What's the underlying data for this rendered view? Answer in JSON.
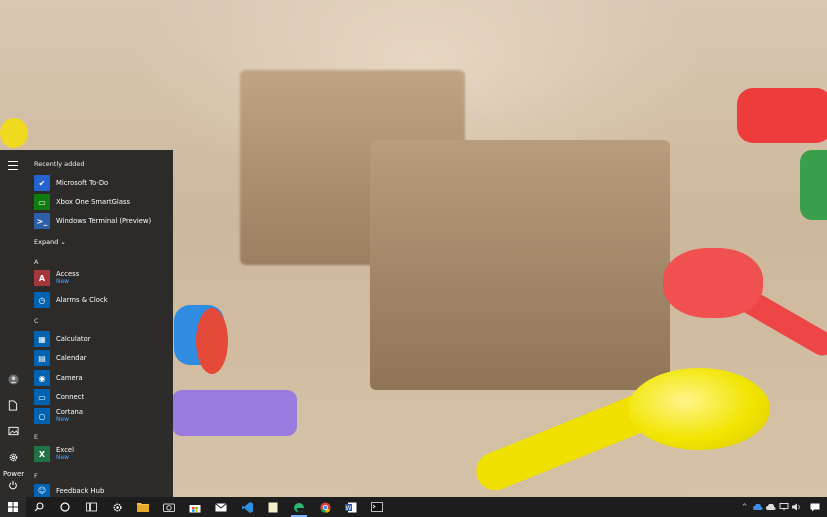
{
  "start_menu": {
    "recently_added_label": "Recently added",
    "recent": [
      {
        "name": "Microsoft To-Do",
        "icon": "checkmark-icon",
        "color": "#2564cf"
      },
      {
        "name": "Xbox One SmartGlass",
        "icon": "xbox-icon",
        "color": "#107c10"
      },
      {
        "name": "Windows Terminal (Preview)",
        "icon": "terminal-icon",
        "color": "#2d5ea8"
      }
    ],
    "expand_label": "Expand ⌄",
    "letters": {
      "a": "A",
      "c": "C",
      "e": "E",
      "f": "F"
    },
    "apps_a": [
      {
        "name": "Access",
        "badge": "New",
        "glyph": "A",
        "color": "#a4373a"
      },
      {
        "name": "Alarms & Clock",
        "badge": "",
        "glyph": "⏰",
        "color": "#0063b1"
      }
    ],
    "apps_c": [
      {
        "name": "Calculator",
        "badge": "",
        "glyph": "▦",
        "color": "#0063b1"
      },
      {
        "name": "Calendar",
        "badge": "",
        "glyph": "▤",
        "color": "#0063b1"
      },
      {
        "name": "Camera",
        "badge": "",
        "glyph": "◉",
        "color": "#0063b1"
      },
      {
        "name": "Connect",
        "badge": "",
        "glyph": "▭",
        "color": "#0063b1"
      },
      {
        "name": "Cortana",
        "badge": "New",
        "glyph": "○",
        "color": "#0063b1"
      }
    ],
    "apps_e": [
      {
        "name": "Excel",
        "badge": "New",
        "glyph": "X",
        "color": "#217346"
      }
    ],
    "apps_f": [
      {
        "name": "Feedback Hub",
        "badge": "",
        "glyph": "☺",
        "color": "#0063b1"
      }
    ],
    "power_tooltip": "Power"
  },
  "taskbar": {
    "items": [
      "start-icon",
      "search-icon",
      "cortana-icon",
      "task-view-icon",
      "settings-icon",
      "file-explorer-icon",
      "camera-icon",
      "store-icon",
      "mail-icon",
      "vscode-icon",
      "notepad-icon",
      "edge-icon",
      "chrome-icon",
      "word-icon",
      "terminal-icon"
    ],
    "tray": [
      "chevron-up-icon",
      "onedrive-icon",
      "cloud-icon",
      "network-icon",
      "volume-icon",
      "notification-icon"
    ]
  }
}
